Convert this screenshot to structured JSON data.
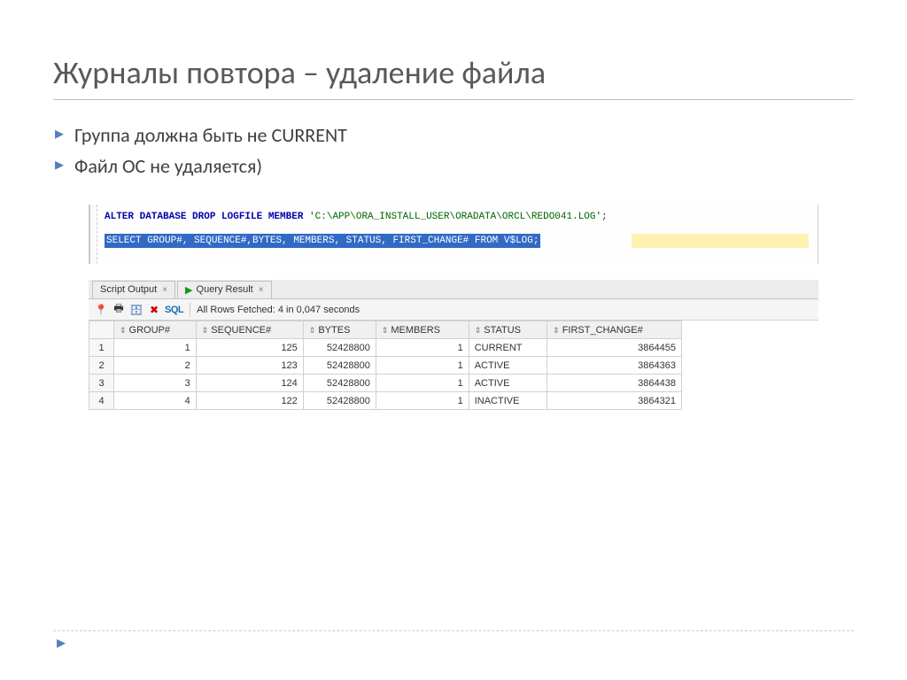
{
  "slide": {
    "title": "Журналы повтора – удаление файла",
    "bullets": [
      "Группа должна быть не CURRENT",
      "Файл ОС не удаляется)"
    ]
  },
  "sql": {
    "alter_kw": "ALTER DATABASE DROP LOGFILE MEMBER",
    "alter_path": "'C:\\APP\\ORA_INSTALL_USER\\ORADATA\\ORCL\\REDO041.LOG'",
    "alter_end": ";",
    "select_line": "SELECT  GROUP#, SEQUENCE#,BYTES, MEMBERS, STATUS, FIRST_CHANGE# FROM V$LOG;"
  },
  "tabs": {
    "script": "Script Output",
    "query": "Query Result"
  },
  "toolbar": {
    "sql_label": "SQL",
    "status": "All Rows Fetched: 4 in 0,047 seconds"
  },
  "grid": {
    "headers": [
      "GROUP#",
      "SEQUENCE#",
      "BYTES",
      "MEMBERS",
      "STATUS",
      "FIRST_CHANGE#"
    ],
    "rows": [
      {
        "n": "1",
        "group": "1",
        "seq": "125",
        "bytes": "52428800",
        "members": "1",
        "status": "CURRENT",
        "first": "3864455"
      },
      {
        "n": "2",
        "group": "2",
        "seq": "123",
        "bytes": "52428800",
        "members": "1",
        "status": "ACTIVE",
        "first": "3864363"
      },
      {
        "n": "3",
        "group": "3",
        "seq": "124",
        "bytes": "52428800",
        "members": "1",
        "status": "ACTIVE",
        "first": "3864438"
      },
      {
        "n": "4",
        "group": "4",
        "seq": "122",
        "bytes": "52428800",
        "members": "1",
        "status": "INACTIVE",
        "first": "3864321"
      }
    ]
  },
  "chart_data": {
    "type": "table",
    "title": "V$LOG query result",
    "columns": [
      "GROUP#",
      "SEQUENCE#",
      "BYTES",
      "MEMBERS",
      "STATUS",
      "FIRST_CHANGE#"
    ],
    "rows": [
      [
        1,
        125,
        52428800,
        1,
        "CURRENT",
        3864455
      ],
      [
        2,
        123,
        52428800,
        1,
        "ACTIVE",
        3864363
      ],
      [
        3,
        124,
        52428800,
        1,
        "ACTIVE",
        3864438
      ],
      [
        4,
        122,
        52428800,
        1,
        "INACTIVE",
        3864321
      ]
    ]
  }
}
